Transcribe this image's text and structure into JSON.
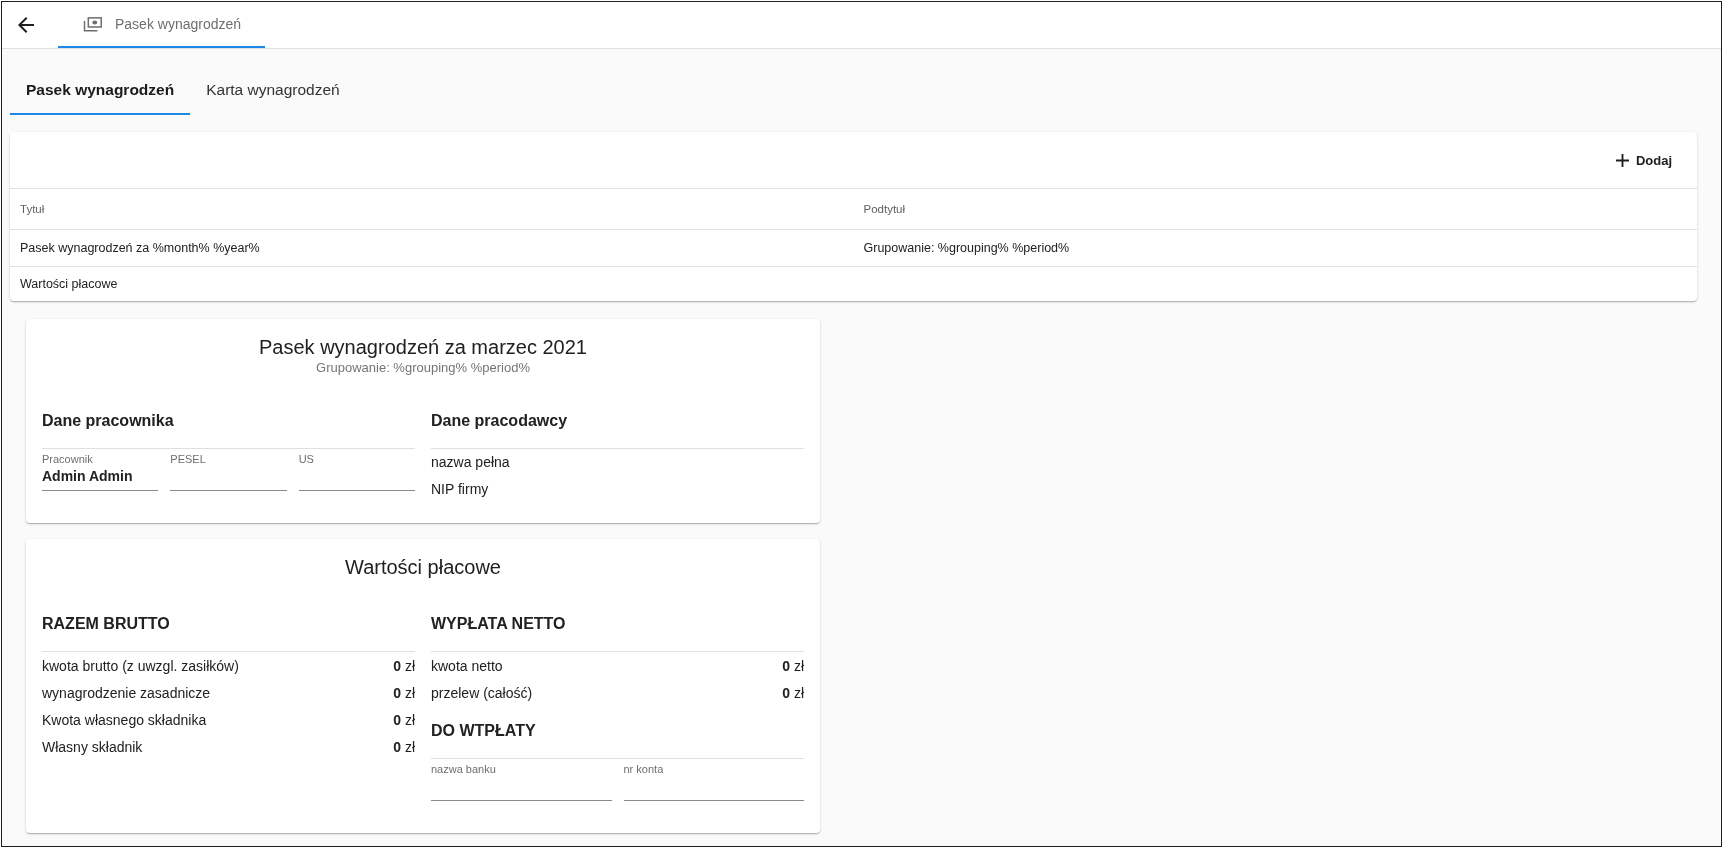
{
  "top_bar": {
    "tabs": [
      {
        "label": "Pasek wynagrodzeń",
        "selected": true
      }
    ]
  },
  "tabs": [
    {
      "label": "Pasek wynagrodzeń",
      "selected": true
    },
    {
      "label": "Karta wynagrodzeń",
      "selected": false
    }
  ],
  "table": {
    "add_button": "Dodaj",
    "columns": [
      "Tytuł",
      "Podtytuł"
    ],
    "rows": [
      [
        "Pasek wynagrodzeń za %month% %year%",
        "Grupowanie: %grouping% %period%"
      ],
      [
        "Wartości płacowe"
      ]
    ]
  },
  "payslip_card": {
    "title": "Pasek wynagrodzeń za marzec 2021",
    "subtitle": "Grupowanie: %grouping% %period%",
    "employee": {
      "heading": "Dane pracownika",
      "fields": [
        {
          "label": "Pracownik",
          "value": "Admin Admin"
        },
        {
          "label": "PESEL"
        },
        {
          "label": "US"
        }
      ]
    },
    "employer": {
      "heading": "Dane pracodawcy",
      "lines": [
        "nazwa pełna",
        "NIP firmy"
      ]
    }
  },
  "values_card": {
    "title": "Wartości płacowe",
    "gross": {
      "heading": "RAZEM BRUTTO",
      "rows": [
        {
          "label": "kwota brutto (z uwzgl. zasiłków)",
          "amount": "**0** zł"
        },
        {
          "label": "wynagrodzenie zasadnicze",
          "amount": "**0** zł"
        },
        {
          "label": "Kwota własnego składnika",
          "amount": "**0** zł"
        },
        {
          "label": "Własny składnik",
          "amount": "**0** zł"
        }
      ]
    },
    "net": {
      "heading": "WYPŁATA NETTO",
      "rows": [
        {
          "label": "kwota netto",
          "amount": "**0** zł"
        },
        {
          "label": "przelew (całość)",
          "amount": "**0** zł"
        }
      ]
    },
    "payment": {
      "heading": "DO WTPŁATY",
      "fields": [
        {
          "label": "nazwa banku"
        },
        {
          "label": "nr konta"
        }
      ]
    }
  }
}
